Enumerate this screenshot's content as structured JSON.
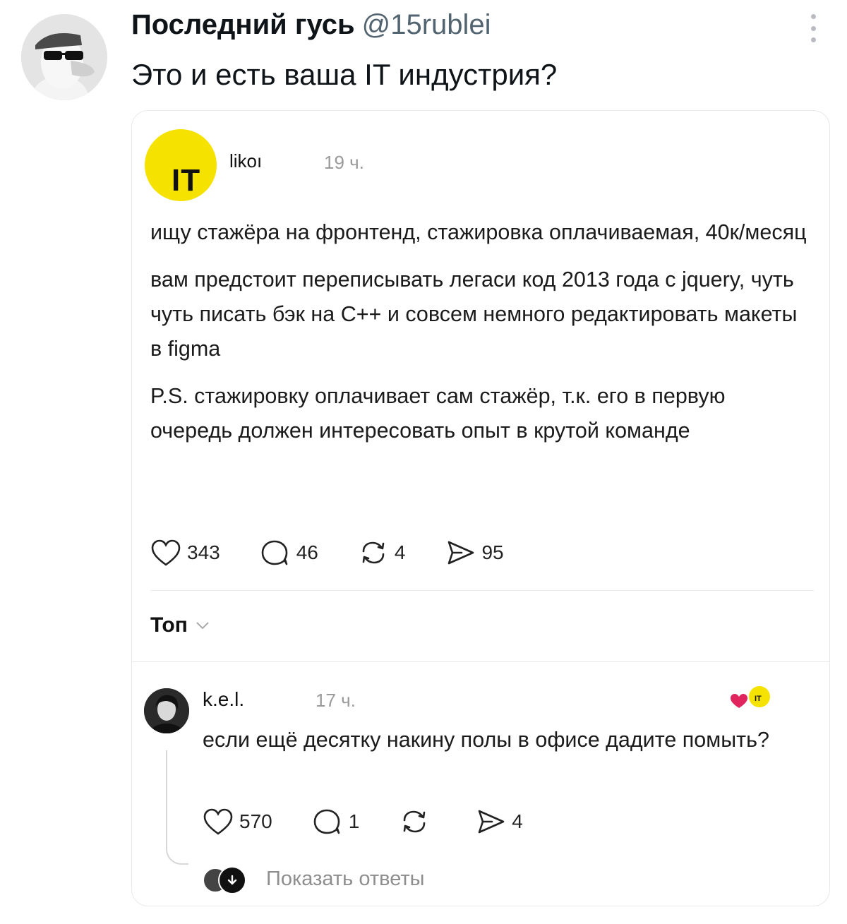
{
  "tweet": {
    "author_name": "Последний гусь",
    "author_handle": "@15rublei",
    "text": "Это и есть ваша IT индустрия?"
  },
  "embedded_post": {
    "avatar_label": "IT",
    "avatar_color": "#f6e200",
    "username": "likoı",
    "time": "19 ч.",
    "paragraphs": [
      "ищу стажёра на фронтенд, стажировка оплачиваемая, 40к/месяц",
      "вам предстоит переписывать легаси код 2013 года с jquery, чуть чуть писать бэк на С++ и совсем немного редактировать макеты в figma",
      "P.S. стажировку оплачивает сам стажёр, т.к. его в первую очередь должен интересовать опыт в крутой команде"
    ],
    "stats": {
      "likes": "343",
      "comments": "46",
      "reposts": "4",
      "shares": "95"
    },
    "sort_label": "Топ"
  },
  "reply": {
    "username": "k.e.l.",
    "time": "17 ч.",
    "liked_badge_label": "IT",
    "text": "если ещё десятку накину полы в офисе дадите помыть?",
    "stats": {
      "likes": "570",
      "comments": "1",
      "shares": "4"
    },
    "show_replies_label": "Показать ответы"
  }
}
